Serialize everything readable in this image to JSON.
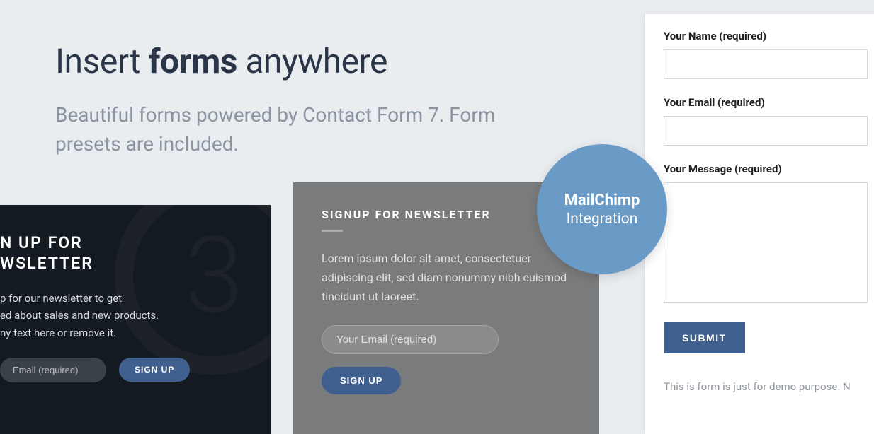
{
  "heading": {
    "part1": "Insert ",
    "bold": "forms",
    "part2": " anywhere"
  },
  "subheading": "Beautiful forms powered by Contact Form 7. Form presets are included.",
  "card1": {
    "title_line1": "N UP FOR",
    "title_line2": "WSLETTER",
    "desc_line1": "p for our newsletter to get",
    "desc_line2": "ed about sales and new products.",
    "desc_line3": "ny text here or remove it.",
    "email_placeholder": "Email (required)",
    "signup_label": "SIGN UP"
  },
  "card2": {
    "title": "SIGNUP FOR NEWSLETTER",
    "desc": "Lorem ipsum dolor sit amet, consectetuer adipiscing elit, sed diam nonummy nibh euismod tincidunt ut laoreet.",
    "email_placeholder": "Your Email (required)",
    "signup_label": "SIGN UP"
  },
  "card3": {
    "name_label": "Your Name (required)",
    "email_label": "Your Email (required)",
    "message_label": "Your Message (required)",
    "submit_label": "SUBMIT",
    "note": "This is form is just for demo purpose. N"
  },
  "badge": {
    "line1": "MailChimp",
    "line2": "Integration"
  }
}
